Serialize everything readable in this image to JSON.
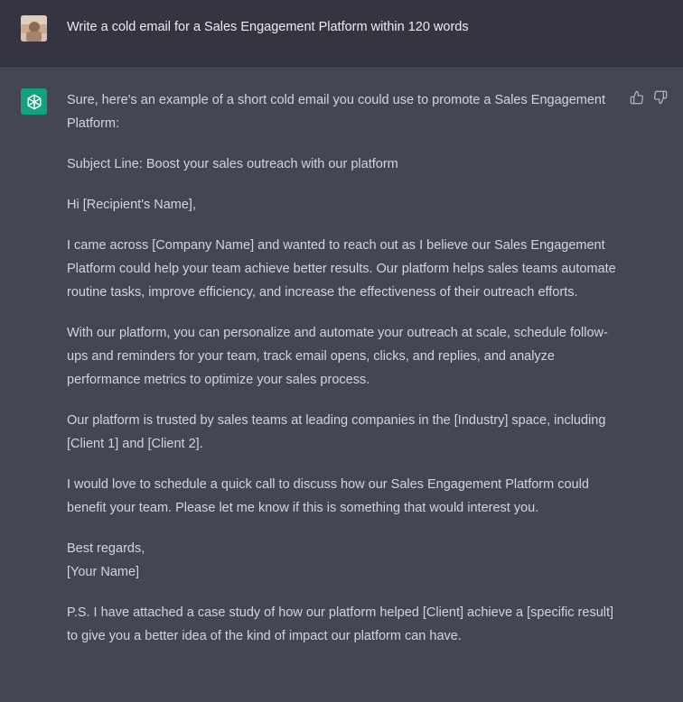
{
  "user_message": {
    "text": "Write a cold email for a Sales Engagement Platform within 120 words",
    "avatar_icon": "user-avatar-photo"
  },
  "assistant_message": {
    "avatar_icon": "openai-logo-icon",
    "avatar_color": "#10a37f",
    "intro": "Sure, here's an example of a short cold email you could use to promote a Sales Engagement Platform:",
    "subject": "Subject Line: Boost your sales outreach with our platform",
    "greeting": "Hi [Recipient's Name],",
    "para1": "I came across [Company Name] and wanted to reach out as I believe our Sales Engagement Platform could help your team achieve better results. Our platform helps sales teams automate routine tasks, improve efficiency, and increase the effectiveness of their outreach efforts.",
    "para2": "With our platform, you can personalize and automate your outreach at scale, schedule follow-ups and reminders for your team, track email opens, clicks, and replies, and analyze performance metrics to optimize your sales process.",
    "para3": "Our platform is trusted by sales teams at leading companies in the [Industry] space, including [Client 1] and [Client 2].",
    "para4": "I would love to schedule a quick call to discuss how our Sales Engagement Platform could benefit your team. Please let me know if this is something that would interest you.",
    "closing_line1": "Best regards,",
    "closing_line2": "[Your Name]",
    "ps": "P.S. I have attached a case study of how our platform helped [Client] achieve a [specific result] to give you a better idea of the kind of impact our platform can have."
  },
  "feedback": {
    "up_icon": "thumbs-up-icon",
    "down_icon": "thumbs-down-icon"
  },
  "colors": {
    "user_bg": "#343541",
    "assistant_bg": "#444654",
    "text": "#d1d5db",
    "accent": "#10a37f"
  }
}
